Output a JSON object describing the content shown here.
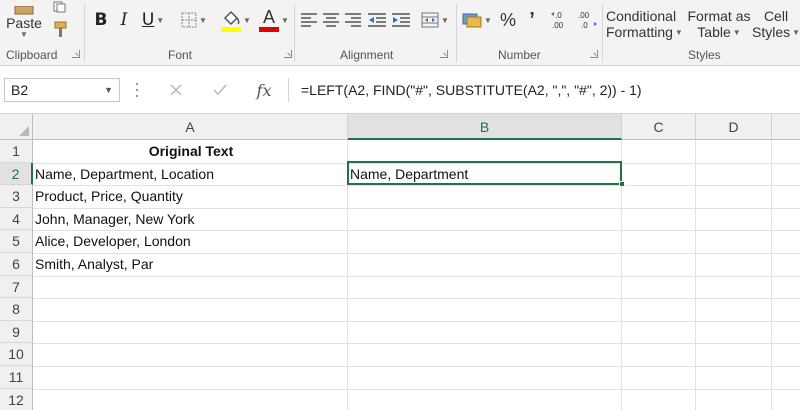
{
  "ribbon": {
    "clipboard": {
      "paste_label": "Paste",
      "group_label": "Clipboard"
    },
    "font": {
      "group_label": "Font",
      "bold": "B",
      "italic": "I",
      "underline": "U",
      "font_color_letter": "A",
      "highlight_color": "#ffff00",
      "font_color": "#e00000"
    },
    "alignment": {
      "group_label": "Alignment"
    },
    "number": {
      "group_label": "Number",
      "percent": "%",
      "comma": "’",
      "increase_decimal": "←.0\n.00",
      "decrease_decimal": ".00\n→.0"
    },
    "styles": {
      "group_label": "Styles",
      "conditional_line1": "Conditional",
      "conditional_line2": "Formatting",
      "format_table_line1": "Format as",
      "format_table_line2": "Table",
      "cell_styles_line1": "Cell",
      "cell_styles_line2": "Styles"
    }
  },
  "formula_bar": {
    "name_box": "B2",
    "fx": "fx",
    "formula": "=LEFT(A2, FIND(\"#\", SUBSTITUTE(A2, \",\", \"#\", 2)) - 1)"
  },
  "sheet": {
    "columns": [
      "A",
      "B",
      "C",
      "D"
    ],
    "rows": [
      "1",
      "2",
      "3",
      "4",
      "5",
      "6",
      "7",
      "8",
      "9",
      "10",
      "11",
      "12"
    ],
    "cells": {
      "A1": "Original Text",
      "A2": "Name, Department, Location",
      "A3": "Product, Price, Quantity",
      "A4": "John, Manager, New York",
      "A5": "Alice, Developer, London",
      "A6": "Smith, Analyst, Par",
      "B2": "Name, Department"
    },
    "selected_cell": "B2"
  },
  "colors": {
    "accent": "#217346",
    "ribbon_bg": "#f3f3f3",
    "header_bg": "#f0f0f0"
  }
}
